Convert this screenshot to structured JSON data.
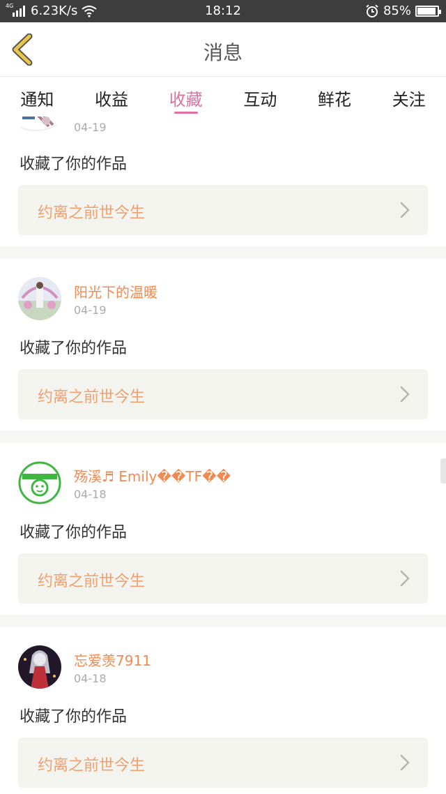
{
  "status_bar": {
    "network_type": "4G",
    "speed": "6.23K/s",
    "time": "18:12",
    "battery": "85%",
    "battery_level": 0.85
  },
  "header": {
    "title": "消息"
  },
  "tabs": [
    {
      "label": "通知",
      "active": false
    },
    {
      "label": "收益",
      "active": false
    },
    {
      "label": "收藏",
      "active": true
    },
    {
      "label": "互动",
      "active": false
    },
    {
      "label": "鲜花",
      "active": false
    },
    {
      "label": "关注",
      "active": false
    }
  ],
  "items": [
    {
      "username": "",
      "date": "04-19",
      "action": "收藏了你的作品",
      "work_title": "约离之前世今生"
    },
    {
      "username": "阳光下的温暖",
      "date": "04-19",
      "action": "收藏了你的作品",
      "work_title": "约离之前世今生"
    },
    {
      "username": "殇溪♬ Emily��TF��",
      "date": "04-18",
      "action": "收藏了你的作品",
      "work_title": "约离之前世今生"
    },
    {
      "username": "忘爱羡7911",
      "date": "04-18",
      "action": "收藏了你的作品",
      "work_title": "约离之前世今生"
    }
  ],
  "colors": {
    "accent": "#e070a0",
    "username": "#f08a50",
    "work_title": "#f0a070",
    "back_arrow": "#e8c84a"
  },
  "icons": {
    "back": "chevron-left-icon",
    "item_arrow": "chevron-right-icon",
    "wifi": "wifi-icon",
    "alarm": "alarm-icon",
    "battery": "battery-icon",
    "signal": "signal-icon"
  }
}
